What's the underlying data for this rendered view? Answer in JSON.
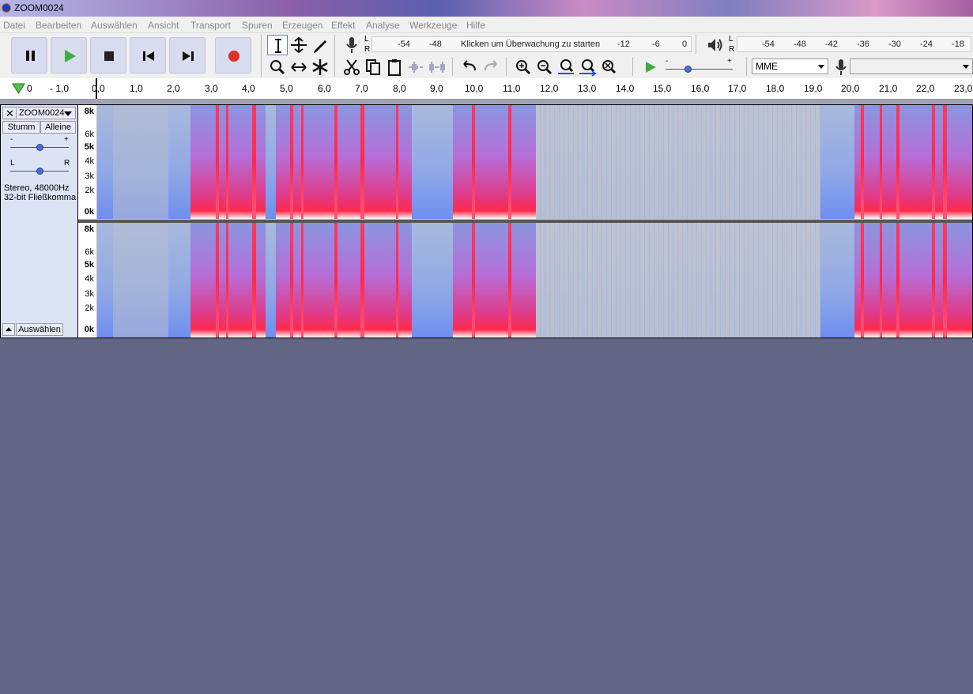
{
  "window": {
    "title": "ZOOM0024"
  },
  "menu": [
    "Datei",
    "Bearbeiten",
    "Auswählen",
    "Ansicht",
    "Transport",
    "Spuren",
    "Erzeugen",
    "Effekt",
    "Analyse",
    "Werkzeuge",
    "Hilfe"
  ],
  "meters": {
    "record": {
      "lr_top": "L",
      "lr_bottom": "R",
      "scale": [
        "-54",
        "-48",
        "Klicken um Überwachung zu starten",
        "-12",
        "-6",
        "0"
      ]
    },
    "playback": {
      "lr_top": "L",
      "lr_bottom": "R",
      "scale": [
        "-54",
        "-48",
        "-42",
        "-36",
        "-30",
        "-24",
        "-18"
      ]
    }
  },
  "play_speed": {
    "minus": "-",
    "plus": "+"
  },
  "device": {
    "host": "MME",
    "input": ""
  },
  "ruler": {
    "labels": [
      "0",
      "- 1,0",
      "0,0",
      "1,0",
      "2,0",
      "3,0",
      "4,0",
      "5,0",
      "6,0",
      "7,0",
      "8,0",
      "9,0",
      "10,0",
      "11,0",
      "12,0",
      "13,0",
      "14,0",
      "15,0",
      "16,0",
      "17,0",
      "18,0",
      "19,0",
      "20,0",
      "21,0",
      "22,0",
      "23,0"
    ]
  },
  "track": {
    "name": "ZOOM0024",
    "mute": "Stumm",
    "solo": "Alleine",
    "gain_minus": "-",
    "gain_plus": "+",
    "pan_left": "L",
    "pan_right": "R",
    "format_line1": "Stereo, 48000Hz",
    "format_line2": "32-bit Fließkomma",
    "select": "Auswählen",
    "freq_labels": [
      "8k",
      "6k",
      "5k",
      "4k",
      "3k",
      "2k",
      "0k"
    ]
  },
  "colors": {
    "background": "#626584",
    "toolbar": "#f0f0f0",
    "transport_button": "#d7dcee",
    "play_green": "#3fae3f",
    "record_red": "#e0302a"
  }
}
